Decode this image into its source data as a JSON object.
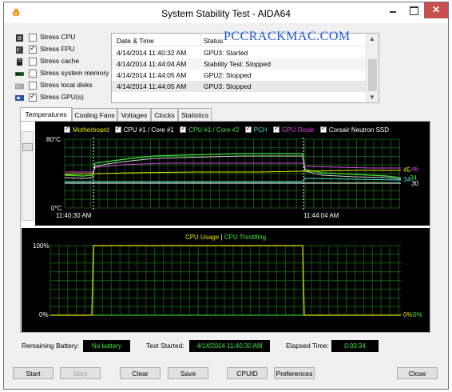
{
  "window": {
    "title": "System Stability Test - AIDA64",
    "close_glyph": "✕"
  },
  "watermark": "PCCRACKMAC.COM",
  "stress": [
    {
      "label": "Stress CPU",
      "checked": false,
      "icon": "cpu-icon"
    },
    {
      "label": "Stress FPU",
      "checked": true,
      "icon": "fpu-icon"
    },
    {
      "label": "Stress cache",
      "checked": false,
      "icon": "cache-icon"
    },
    {
      "label": "Stress system memory",
      "checked": false,
      "icon": "memory-icon"
    },
    {
      "label": "Stress local disks",
      "checked": false,
      "icon": "disk-icon"
    },
    {
      "label": "Stress GPU(s)",
      "checked": true,
      "icon": "gpu-icon"
    }
  ],
  "log": {
    "headers": {
      "date": "Date & Time",
      "status": "Status"
    },
    "rows": [
      {
        "date": "4/14/2014 11:40:32 AM",
        "status": "GPU3: Started"
      },
      {
        "date": "4/14/2014 11:44:04 AM",
        "status": "Stability Test: Stopped"
      },
      {
        "date": "4/14/2014 11:44:05 AM",
        "status": "GPU2: Stopped"
      },
      {
        "date": "4/14/2014 11:44:05 AM",
        "status": "GPU3: Stopped"
      }
    ]
  },
  "tabs": [
    "Temperatures",
    "Cooling Fans",
    "Voltages",
    "Clocks",
    "Statistics"
  ],
  "temp_graph": {
    "legend": [
      {
        "label": "Motherboard",
        "color": "#e8e800"
      },
      {
        "label": "CPU #1 / Core #1",
        "color": "#ffffff"
      },
      {
        "label": "CPU #1 / Core #2",
        "color": "#3ee83e"
      },
      {
        "label": "PCH",
        "color": "#44dddd"
      },
      {
        "label": "GPU Diode",
        "color": "#e040e0"
      },
      {
        "label": "Corsair Neutron SSD",
        "color": "#ffffff"
      }
    ],
    "y_top": "80°C",
    "y_bottom": "0°C",
    "x_start": "11:40:30 AM",
    "x_end": "11:44:04 AM",
    "end_labels": [
      {
        "text": "45",
        "color": "#e8e800"
      },
      {
        "text": "46",
        "color": "#e040e0"
      },
      {
        "text": "34",
        "color": "#44dddd"
      },
      {
        "text": "34",
        "color": "#3ee83e"
      },
      {
        "text": "30",
        "color": "#ffffff"
      }
    ]
  },
  "cpu_graph": {
    "title_usage": "CPU Usage",
    "separator": "|",
    "title_throttling": "CPU Throttling",
    "y_top": "100%",
    "y_bottom": "0%",
    "end_label_usage": "0%",
    "end_label_throttling": "0%",
    "usage_color": "#e8e800",
    "throttling_color": "#3ee83e"
  },
  "status": {
    "battery_label": "Remaining Battery:",
    "battery_value": "No battery",
    "started_label": "Test Started:",
    "started_value": "4/14/2014 11:40:30 AM",
    "elapsed_label": "Elapsed Time:",
    "elapsed_value": "0:03:34"
  },
  "buttons": {
    "start": "Start",
    "stop": "Stop",
    "clear": "Clear",
    "save": "Save",
    "cpuid": "CPUID",
    "preferences": "Preferences",
    "close": "Close"
  }
}
